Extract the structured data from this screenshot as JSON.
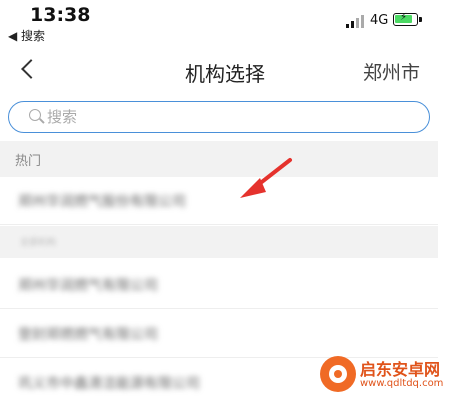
{
  "status_bar": {
    "time": "13:38",
    "back_app": "◀ 搜索",
    "network": "4G",
    "icons": [
      "signal-icon",
      "battery-charging-icon"
    ]
  },
  "nav": {
    "back_icon": "chevron-left-icon",
    "title": "机构选择",
    "city": "郑州市"
  },
  "search": {
    "placeholder": "搜索",
    "value": "",
    "icon": "search-icon"
  },
  "sections": {
    "hot_label": "热门",
    "other_label": "全部机构"
  },
  "list": {
    "hot_items": [
      "郑州华润燃气股份有限公司"
    ],
    "other_items": [
      "郑州华润燃气有限公司",
      "登封郑燃燃气有限公司",
      "巩义市中鑫清洁能源有限公司"
    ]
  },
  "annotation": {
    "arrow_color": "#e5322d",
    "icon": "red-arrow-icon"
  },
  "watermark": {
    "name": "启东安卓网",
    "url": "www.qdltdq.com"
  },
  "colors": {
    "accent": "#4a90d9",
    "section_bg": "#f2f2f2",
    "watermark": "#f06a25"
  }
}
